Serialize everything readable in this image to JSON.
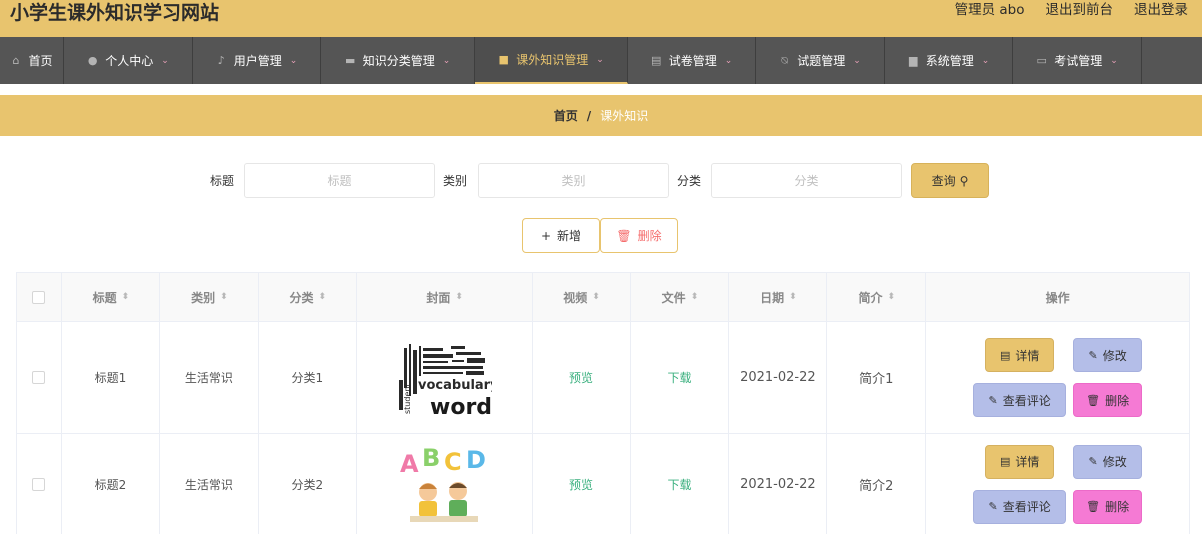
{
  "header": {
    "site_title": "小学生课外知识学习网站",
    "admin_label": "管理员 abo",
    "back_front": "退出到前台",
    "logout": "退出登录"
  },
  "nav": [
    {
      "label": "首页",
      "icon": "home-icon",
      "chevron": false
    },
    {
      "label": "个人中心",
      "icon": "user-icon",
      "chevron": true
    },
    {
      "label": "用户管理",
      "icon": "microphone-icon",
      "chevron": true
    },
    {
      "label": "知识分类管理",
      "icon": "chat-icon",
      "chevron": true
    },
    {
      "label": "课外知识管理",
      "icon": "clipboard-icon",
      "chevron": true,
      "active": true
    },
    {
      "label": "试卷管理",
      "icon": "document-icon",
      "chevron": true
    },
    {
      "label": "试题管理",
      "icon": "bell-off-icon",
      "chevron": true
    },
    {
      "label": "系统管理",
      "icon": "briefcase-icon",
      "chevron": true
    },
    {
      "label": "考试管理",
      "icon": "message-icon",
      "chevron": true
    }
  ],
  "breadcrumb": {
    "home": "首页",
    "separator": "/",
    "current": "课外知识"
  },
  "search": {
    "title_label": "标题",
    "title_placeholder": "标题",
    "category_label": "类别",
    "category_placeholder": "类别",
    "class_label": "分类",
    "class_placeholder": "分类",
    "query_button": "查询"
  },
  "actions": {
    "add": "新增",
    "delete": "删除"
  },
  "table": {
    "columns": [
      "标题",
      "类别",
      "分类",
      "封面",
      "视频",
      "文件",
      "日期",
      "简介",
      "操作"
    ],
    "rows": [
      {
        "title": "标题1",
        "type": "生活常识",
        "class": "分类1",
        "cover": "words-wordcloud-image",
        "video": "预览",
        "file": "下载",
        "date": "2021-02-22",
        "intro": "简介1"
      },
      {
        "title": "标题2",
        "type": "生活常识",
        "class": "分类2",
        "cover": "abcd-kids-image",
        "video": "预览",
        "file": "下载",
        "date": "2021-02-22",
        "intro": "简介2"
      }
    ],
    "ops": {
      "detail": "详情",
      "edit": "修改",
      "comment": "查看评论",
      "delete": "删除"
    }
  },
  "colors": {
    "accent": "#e8c46e",
    "nav_bg": "#555555",
    "link_green": "#3bb07f",
    "edit_btn": "#b4bee8",
    "delete_btn": "#f57ad4"
  }
}
